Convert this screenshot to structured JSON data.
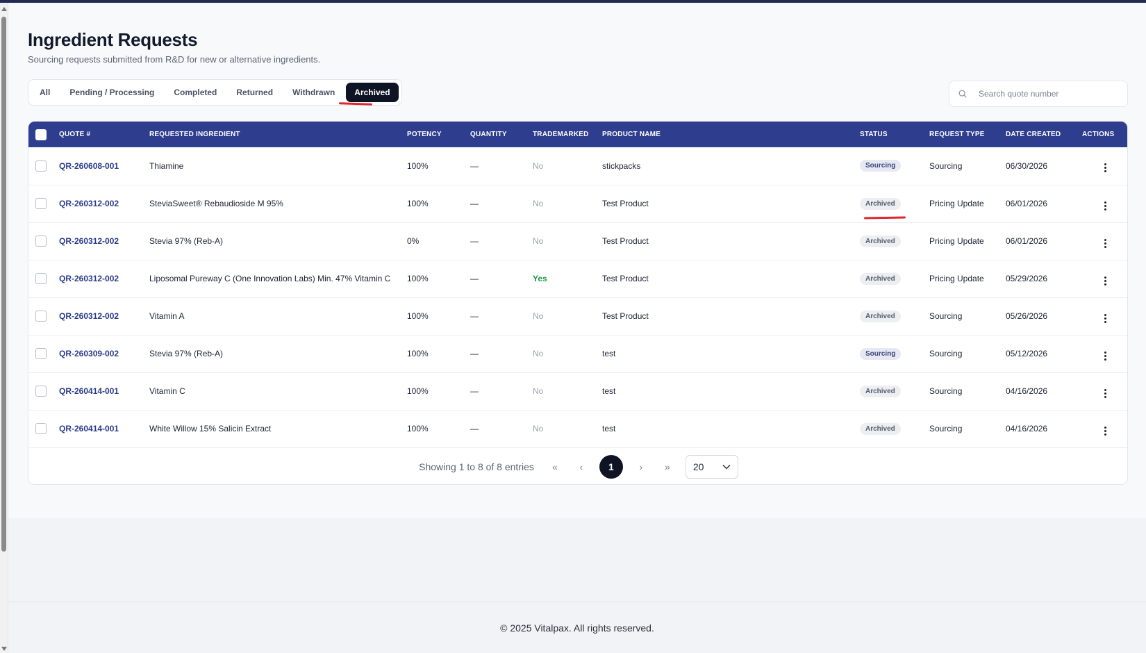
{
  "page": {
    "title": "Ingredient Requests",
    "subtitle": "Sourcing requests submitted from R&D for new or alternative ingredients."
  },
  "tabs": [
    {
      "label": "All",
      "active": false
    },
    {
      "label": "Pending / Processing",
      "active": false
    },
    {
      "label": "Completed",
      "active": false
    },
    {
      "label": "Returned",
      "active": false
    },
    {
      "label": "Withdrawn",
      "active": false
    },
    {
      "label": "Archived",
      "active": true
    }
  ],
  "search": {
    "placeholder": "Search quote number",
    "icon": "search-icon"
  },
  "table": {
    "columns": [
      "QUOTE #",
      "REQUESTED INGREDIENT",
      "POTENCY",
      "QUANTITY",
      "TRADEMARKED",
      "PRODUCT NAME",
      "STATUS",
      "REQUEST TYPE",
      "DATE CREATED",
      "ACTIONS"
    ],
    "rows": [
      {
        "quote": "QR-260608-001",
        "ingredient": "Thiamine",
        "potency": "100%",
        "quantity": "—",
        "trademarked": "No",
        "product": "stickpacks",
        "status": "Sourcing",
        "type": "Sourcing",
        "date": "06/30/2026"
      },
      {
        "quote": "QR-260312-002",
        "ingredient": "SteviaSweet® Rebaudioside M 95%",
        "potency": "100%",
        "quantity": "—",
        "trademarked": "No",
        "product": "Test Product",
        "status": "Archived",
        "type": "Pricing Update",
        "date": "06/01/2026"
      },
      {
        "quote": "QR-260312-002",
        "ingredient": "Stevia 97% (Reb-A)",
        "potency": "0%",
        "quantity": "—",
        "trademarked": "No",
        "product": "Test Product",
        "status": "Archived",
        "type": "Pricing Update",
        "date": "06/01/2026"
      },
      {
        "quote": "QR-260312-002",
        "ingredient": "Liposomal Pureway C (One Innovation Labs) Min. 47% Vitamin C",
        "potency": "100%",
        "quantity": "—",
        "trademarked": "Yes",
        "product": "Test Product",
        "status": "Archived",
        "type": "Pricing Update",
        "date": "05/29/2026"
      },
      {
        "quote": "QR-260312-002",
        "ingredient": "Vitamin A",
        "potency": "100%",
        "quantity": "—",
        "trademarked": "No",
        "product": "Test Product",
        "status": "Archived",
        "type": "Sourcing",
        "date": "05/26/2026"
      },
      {
        "quote": "QR-260309-002",
        "ingredient": "Stevia 97% (Reb-A)",
        "potency": "100%",
        "quantity": "—",
        "trademarked": "No",
        "product": "test",
        "status": "Sourcing",
        "type": "Sourcing",
        "date": "05/12/2026"
      },
      {
        "quote": "QR-260414-001",
        "ingredient": "Vitamin C",
        "potency": "100%",
        "quantity": "—",
        "trademarked": "No",
        "product": "test",
        "status": "Archived",
        "type": "Sourcing",
        "date": "04/16/2026"
      },
      {
        "quote": "QR-260414-001",
        "ingredient": "White Willow 15% Salicin Extract",
        "potency": "100%",
        "quantity": "—",
        "trademarked": "No",
        "product": "test",
        "status": "Archived",
        "type": "Sourcing",
        "date": "04/16/2026"
      }
    ]
  },
  "pagination": {
    "summary": "Showing 1 to 8 of 8 entries",
    "first": "«",
    "prev": "‹",
    "current": "1",
    "next": "›",
    "last": "»",
    "page_size": "20"
  },
  "footer": {
    "text": "© 2025 Vitalpax. All rights reserved."
  },
  "colors": {
    "header_bg": "#2f3d8e",
    "active_tab": "#0e1424",
    "link": "#2a3a8c",
    "yes": "#1e9b4b",
    "annotation": "#e0262b"
  }
}
